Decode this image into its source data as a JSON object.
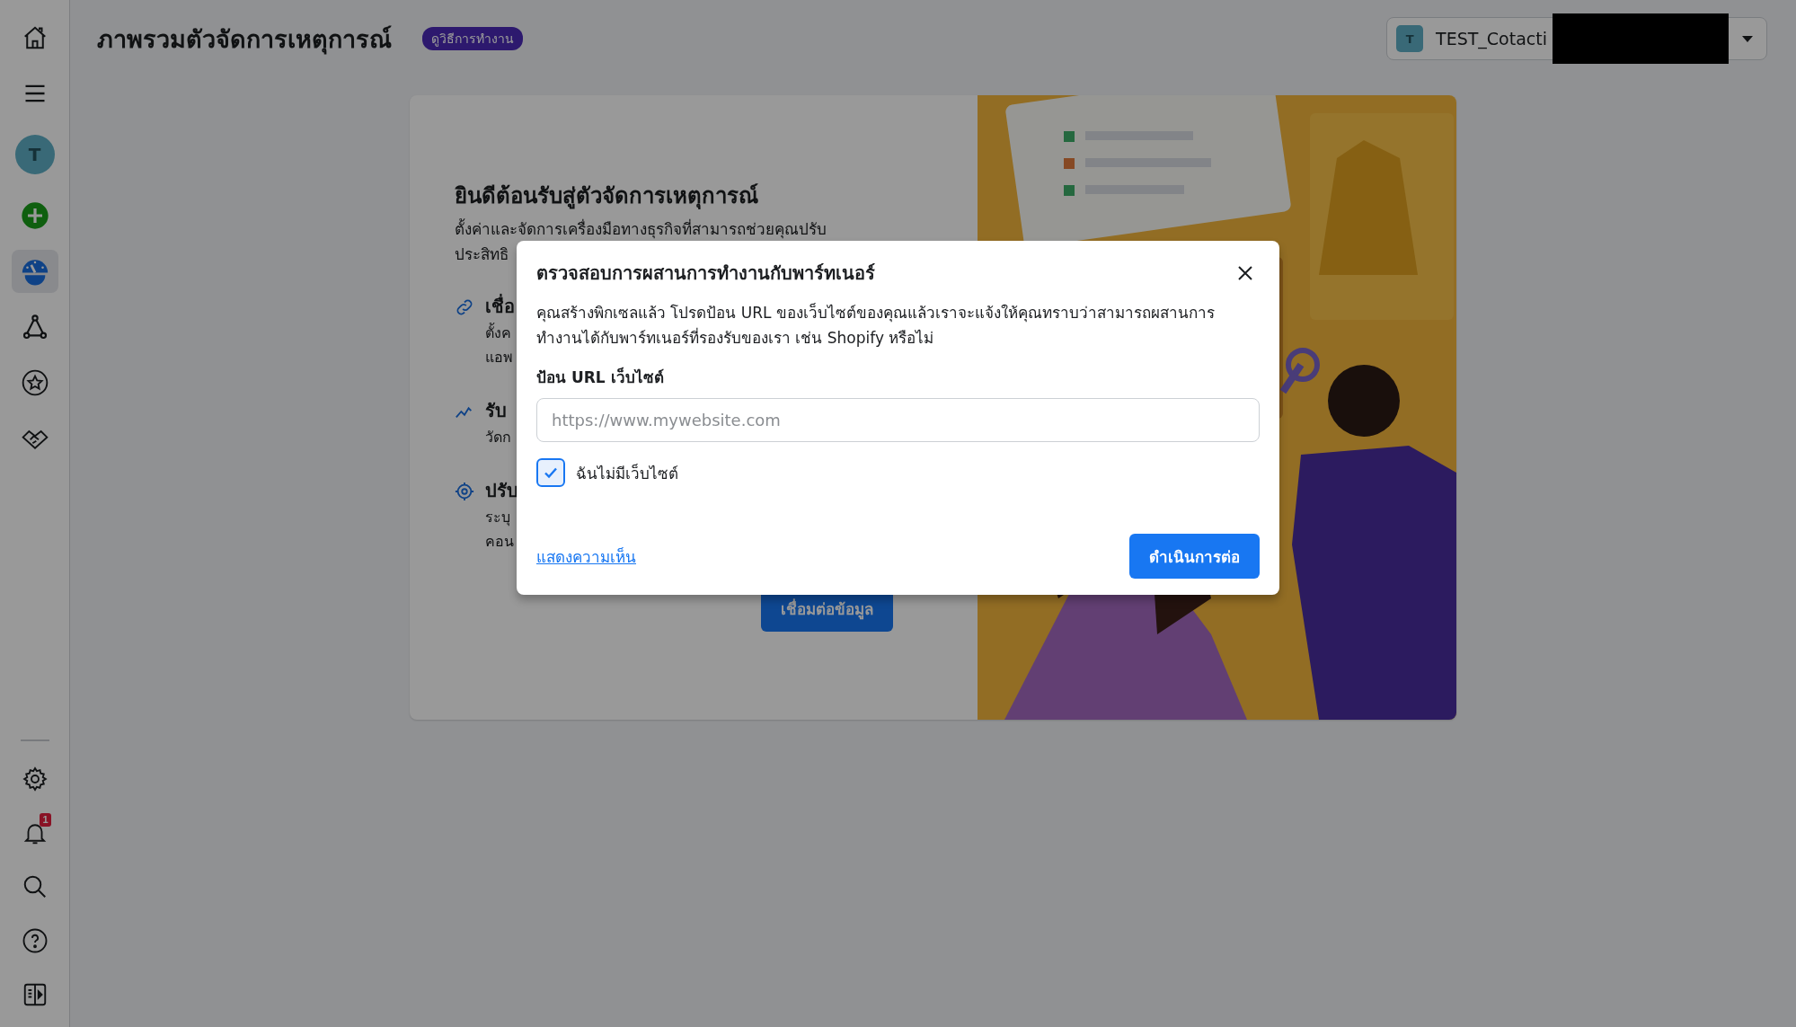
{
  "sidebar": {
    "top_items": [
      {
        "kind": "home",
        "selected": false
      },
      {
        "kind": "menu",
        "selected": false
      },
      {
        "kind": "avatar",
        "label": "T",
        "selected": false
      },
      {
        "kind": "create",
        "selected": false
      },
      {
        "kind": "gauge",
        "selected": true
      },
      {
        "kind": "nodes",
        "selected": false
      },
      {
        "kind": "star",
        "selected": false
      },
      {
        "kind": "handshake",
        "selected": false
      }
    ],
    "bottom_items": [
      {
        "kind": "settings",
        "selected": false
      },
      {
        "kind": "bell",
        "badge": "1",
        "selected": false
      },
      {
        "kind": "search",
        "selected": false
      },
      {
        "kind": "help",
        "selected": false
      },
      {
        "kind": "panel",
        "selected": false
      }
    ]
  },
  "header": {
    "title": "ภาพรวมตัวจัดการเหตุการณ์",
    "help_badge": "ดูวิธีการทำงาน",
    "account": {
      "initial": "T",
      "name": "TEST_Cotacti"
    }
  },
  "card": {
    "title": "ยินดีต้อนรับสู่ตัวจัดการเหตุการณ์",
    "description": [
      "ตั้งค่าและจัดการเครื่องมือทางธุรกิจที่สามารถช่วยคุณปรับ",
      "ประสิทธิ"
    ],
    "features": [
      {
        "kind": "link",
        "title": "เชื่อ",
        "lines": [
          "ตั้งค",
          "แอพ"
        ]
      },
      {
        "kind": "chart",
        "title": "รับ",
        "lines": [
          "วัดก"
        ]
      },
      {
        "kind": "target",
        "title": "ปรับ",
        "lines": [
          "ระบุ",
          "คอน"
        ]
      }
    ],
    "button": "เชื่อมต่อข้อมูล"
  },
  "dialog": {
    "title": "ตรวจสอบการผสานการทำงานกับพาร์ทเนอร์",
    "body": "คุณสร้างพิกเซลแล้ว โปรดป้อน URL ของเว็บไซต์ของคุณแล้วเราจะแจ้งให้คุณทราบว่าสามารถผสานการทำงานได้กับพาร์ทเนอร์ที่รองรับของเรา เช่น Shopify หรือไม่",
    "field_label": "ป้อน URL เว็บไซต์",
    "placeholder": "https://www.mywebsite.com",
    "checkbox": {
      "label": "ฉันไม่มีเว็บไซต์",
      "checked": true
    },
    "link": "แสดงความเห็น",
    "primary_button": "ดำเนินการต่อ"
  }
}
